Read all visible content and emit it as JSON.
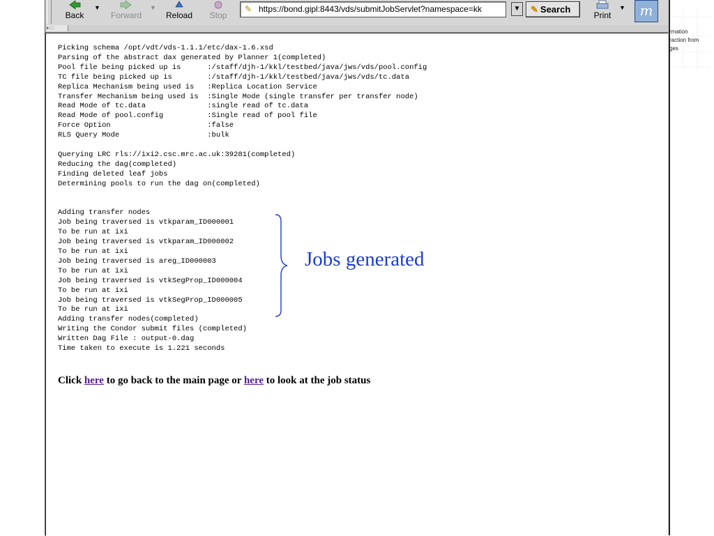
{
  "toolbar": {
    "back_label": "Back",
    "forward_label": "Forward",
    "reload_label": "Reload",
    "stop_label": "Stop",
    "url": "https://bond.gipl:8443/vds/submitJobServlet?namespace=kk",
    "search_label": "Search",
    "print_label": "Print"
  },
  "console_lines": [
    "Picking schema /opt/vdt/vds-1.1.1/etc/dax-1.6.xsd",
    "Parsing of the abstract dax generated by Planner 1(completed)",
    "Pool file being picked up is      :/staff/djh-1/kkl/testbed/java/jws/vds/pool.config",
    "TC file being picked up is        :/staff/djh-1/kkl/testbed/java/jws/vds/tc.data",
    "Replica Mechanism being used is   :Replica Location Service",
    "Transfer Mechanism being used is  :Single Mode (single transfer per transfer node)",
    "Read Mode of tc.data              :single read of tc.data",
    "Read Mode of pool.config          :Single read of pool file",
    "Force Option                      :false",
    "RLS Query Mode                    :bulk",
    "",
    "Querying LRC rls://ixi2.csc.mrc.ac.uk:39281(completed)",
    "Reducing the dag(completed)",
    "Finding deleted leaf jobs",
    "Determining pools to run the dag on(completed)",
    "",
    "",
    "Adding transfer nodes",
    "Job being traversed is vtkparam_ID000001",
    "To be run at ixi",
    "Job being traversed is vtkparam_ID000002",
    "To be run at ixi",
    "Job being traversed is areg_ID000003",
    "To be run at ixi",
    "Job being traversed is vtkSegProp_ID000004",
    "To be run at ixi",
    "Job being traversed is vtkSegProp_ID000005",
    "To be run at ixi",
    "Adding transfer nodes(completed)",
    "Writing the Condor submit files (completed)",
    "Written Dag File : output-0.dag",
    "Time taken to execute is 1.221 seconds"
  ],
  "annotation": "Jobs generated",
  "footer": {
    "click": "Click ",
    "link1": "here",
    "middle": " to go back to the main page or ",
    "link2": "here",
    "end": " to look at the job status"
  },
  "side_text": [
    "rmation",
    "raction  from",
    "ges"
  ]
}
